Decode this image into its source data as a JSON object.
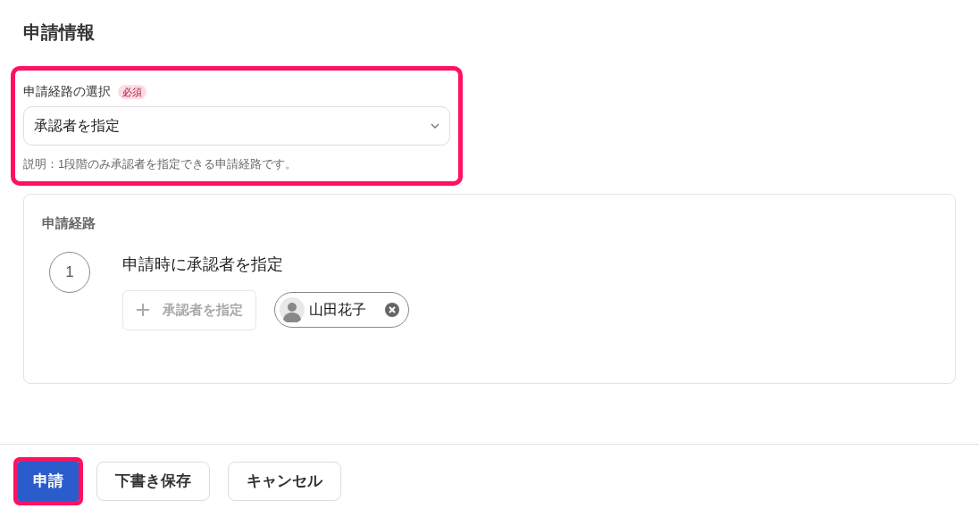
{
  "title": "申請情報",
  "route_select": {
    "label": "申請経路の選択",
    "required_badge": "必須",
    "value": "承認者を指定",
    "description": "説明：1段階のみ承認者を指定できる申請経路です。",
    "highlighted": true
  },
  "route_card": {
    "title": "申請経路",
    "steps": [
      {
        "number": "1",
        "title": "申請時に承認者を指定",
        "add_button": "承認者を指定",
        "approvers": [
          {
            "name": "山田花子"
          }
        ]
      }
    ]
  },
  "footer_buttons": [
    {
      "label": "申請",
      "kind": "primary",
      "highlighted": true
    },
    {
      "label": "下書き保存",
      "kind": "secondary",
      "highlighted": false
    },
    {
      "label": "キャンセル",
      "kind": "secondary",
      "highlighted": false
    }
  ]
}
